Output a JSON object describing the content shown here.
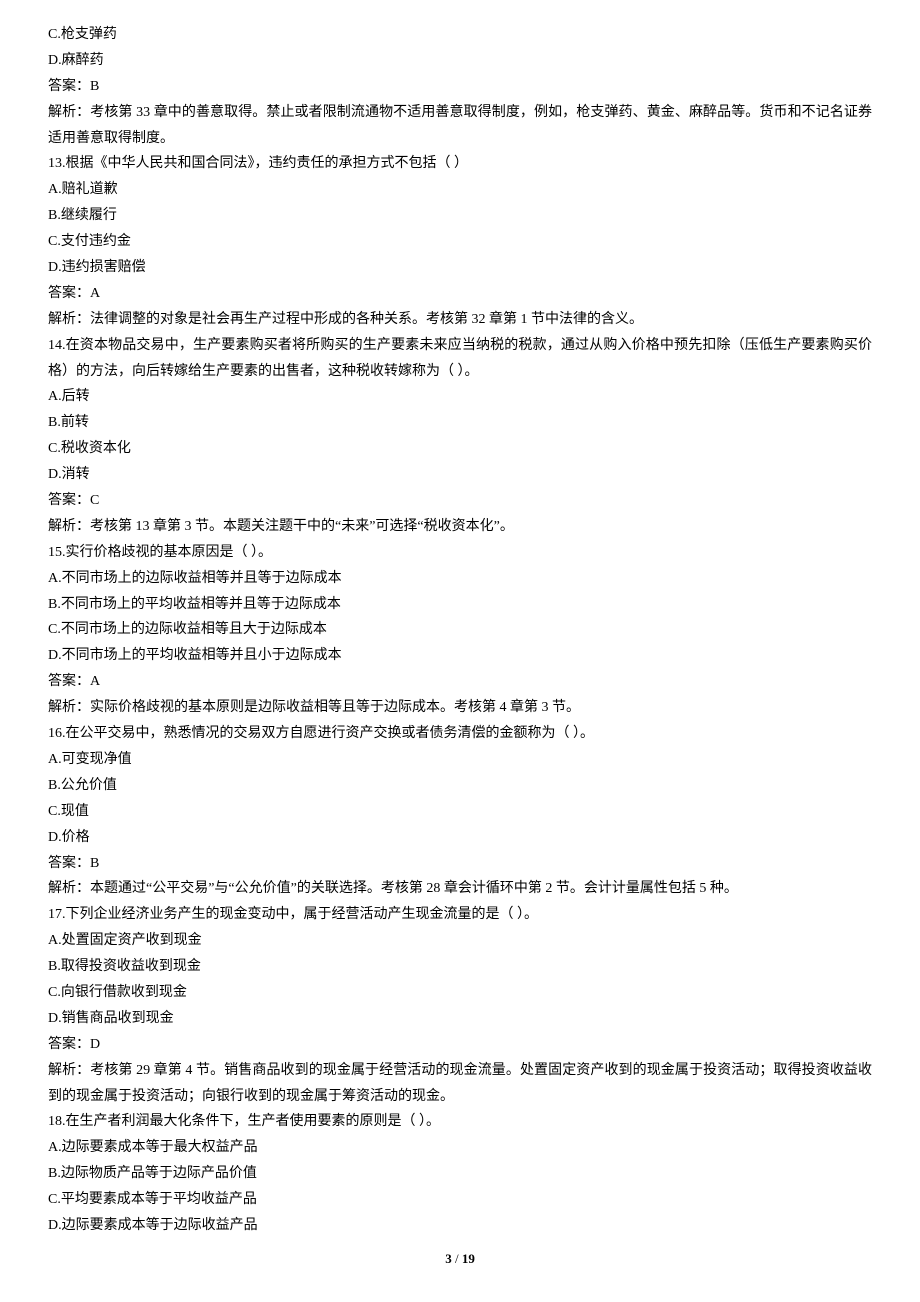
{
  "lines": [
    "C.枪支弹药",
    "D.麻醉药",
    "答案：B",
    "解析：考核第 33 章中的善意取得。禁止或者限制流通物不适用善意取得制度，例如，枪支弹药、黄金、麻醉品等。货币和不记名证券适用善意取得制度。",
    "13.根据《中华人民共和国合同法》，违约责任的承担方式不包括（ ）",
    "A.赔礼道歉",
    "B.继续履行",
    "C.支付违约金",
    "D.违约损害赔偿",
    "答案：A",
    "解析：法律调整的对象是社会再生产过程中形成的各种关系。考核第 32 章第 1 节中法律的含义。",
    "14.在资本物品交易中，生产要素购买者将所购买的生产要素未来应当纳税的税款，通过从购入价格中预先扣除（压低生产要素购买价格）的方法，向后转嫁给生产要素的出售者，这种税收转嫁称为（ ）。",
    "A.后转",
    "B.前转",
    "C.税收资本化",
    "D.消转",
    "答案：C",
    "解析：考核第 13 章第 3 节。本题关注题干中的“未来”可选择“税收资本化”。",
    "15.实行价格歧视的基本原因是（ ）。",
    "A.不同市场上的边际收益相等并且等于边际成本",
    "B.不同市场上的平均收益相等并且等于边际成本",
    "C.不同市场上的边际收益相等且大于边际成本",
    "D.不同市场上的平均收益相等并且小于边际成本",
    "答案：A",
    "解析：实际价格歧视的基本原则是边际收益相等且等于边际成本。考核第 4 章第 3 节。",
    "16.在公平交易中，熟悉情况的交易双方自愿进行资产交换或者债务清偿的金额称为（ ）。",
    "A.可变现净值",
    "B.公允价值",
    "C.现值",
    "D.价格",
    "答案：B",
    "解析：本题通过“公平交易”与“公允价值”的关联选择。考核第 28 章会计循环中第 2 节。会计计量属性包括 5 种。",
    "17.下列企业经济业务产生的现金变动中，属于经营活动产生现金流量的是（ ）。",
    "A.处置固定资产收到现金",
    "B.取得投资收益收到现金",
    "C.向银行借款收到现金",
    "D.销售商品收到现金",
    "答案：D",
    "解析：考核第 29 章第 4 节。销售商品收到的现金属于经营活动的现金流量。处置固定资产收到的现金属于投资活动；取得投资收益收到的现金属于投资活动；向银行收到的现金属于筹资活动的现金。",
    "18.在生产者利润最大化条件下，生产者使用要素的原则是（ ）。",
    "A.边际要素成本等于最大权益产品",
    "B.边际物质产品等于边际产品价值",
    "C.平均要素成本等于平均收益产品",
    "D.边际要素成本等于边际收益产品"
  ],
  "footer": {
    "current": "3",
    "sep": " / ",
    "total": "19"
  }
}
